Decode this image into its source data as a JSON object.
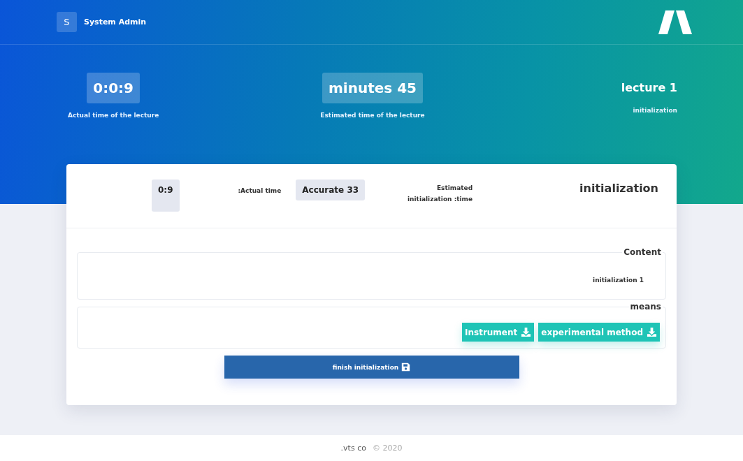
{
  "user": {
    "initial": "S",
    "name": "System Admin"
  },
  "stats": [
    {
      "kind": "badge",
      "value": "0:0:9",
      "label": "Actual time of the lecture"
    },
    {
      "kind": "badge",
      "value": "minutes 45",
      "label": "Estimated time of the lecture"
    },
    {
      "kind": "plain",
      "value": "lecture 1",
      "label": "initialization"
    }
  ],
  "card": {
    "title": "initialization",
    "estimated_label": "Estimated initialization :time",
    "estimated_value": "Accurate 33",
    "actual_label": ":Actual time",
    "actual_value": "0:9"
  },
  "sections": [
    {
      "kind": "text",
      "title": "Content",
      "text": "initialization 1"
    },
    {
      "kind": "downloads",
      "title": "means",
      "buttons": [
        "Instrument",
        "experimental method"
      ]
    }
  ],
  "finish_button": "finish initialization",
  "footer": {
    "company": ".vts co",
    "copyright": "© 2020"
  }
}
